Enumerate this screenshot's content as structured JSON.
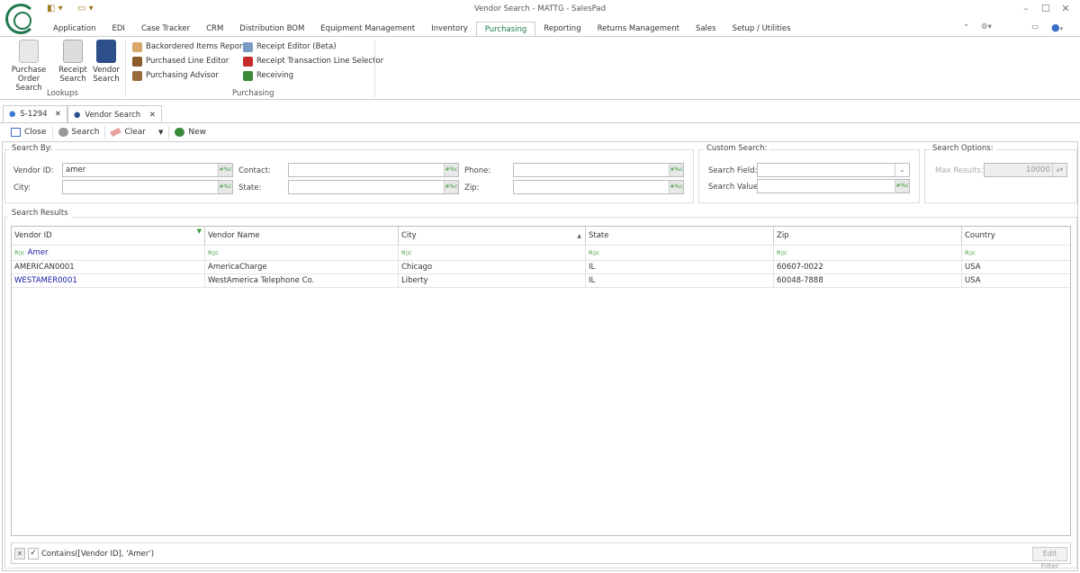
{
  "window": {
    "title": "Vendor Search - MATTG - SalesPad"
  },
  "menu_tabs": [
    "Application",
    "EDI",
    "Case Tracker",
    "CRM",
    "Distribution BOM",
    "Equipment Management",
    "Inventory",
    "Purchasing",
    "Reporting",
    "Returns Management",
    "Sales",
    "Setup / Utilities"
  ],
  "active_tab": "Purchasing",
  "ribbon": {
    "lookups": {
      "label": "Lookups",
      "buttons": [
        {
          "l1": "Purchase",
          "l2": "Order Search"
        },
        {
          "l1": "Receipt",
          "l2": "Search"
        },
        {
          "l1": "Vendor",
          "l2": "Search"
        }
      ]
    },
    "purchasing": {
      "label": "Purchasing",
      "items": [
        "Backordered Items Report",
        "Purchased Line Editor",
        "Purchasing Advisor",
        "Receipt Editor (Beta)",
        "Receipt Transaction Line Selector",
        "Receiving"
      ]
    }
  },
  "doc_tabs": [
    "S-1294",
    "Vendor Search"
  ],
  "toolbar": {
    "close": "Close",
    "search": "Search",
    "clear": "Clear",
    "new": "New"
  },
  "search_by": {
    "legend": "Search By:",
    "vendor_id_label": "Vendor ID:",
    "vendor_id": "amer",
    "city_label": "City:",
    "contact_label": "Contact:",
    "state_label": "State:",
    "phone_label": "Phone:",
    "zip_label": "Zip:",
    "pct": "#%c"
  },
  "custom_search": {
    "legend": "Custom Search:",
    "field_label": "Search Field:",
    "value_label": "Search Value:"
  },
  "search_options": {
    "legend": "Search Options:",
    "max_label": "Max Results:",
    "max_value": "10000"
  },
  "results": {
    "legend": "Search Results",
    "columns": [
      "Vendor ID",
      "Vendor Name",
      "City",
      "State",
      "Zip",
      "Country"
    ],
    "filter_value": "Amer",
    "rows": [
      [
        "AMERICAN0001",
        "AmericaCharge",
        "Chicago",
        "IL",
        "60607-0022",
        "USA"
      ],
      [
        "WESTAMER0001",
        "WestAmerica Telephone Co.",
        "Liberty",
        "IL",
        "60048-7888",
        "USA"
      ]
    ],
    "filter_text": "Contains([Vendor ID], 'Amer')",
    "edit_filter": "Edit Filter"
  }
}
